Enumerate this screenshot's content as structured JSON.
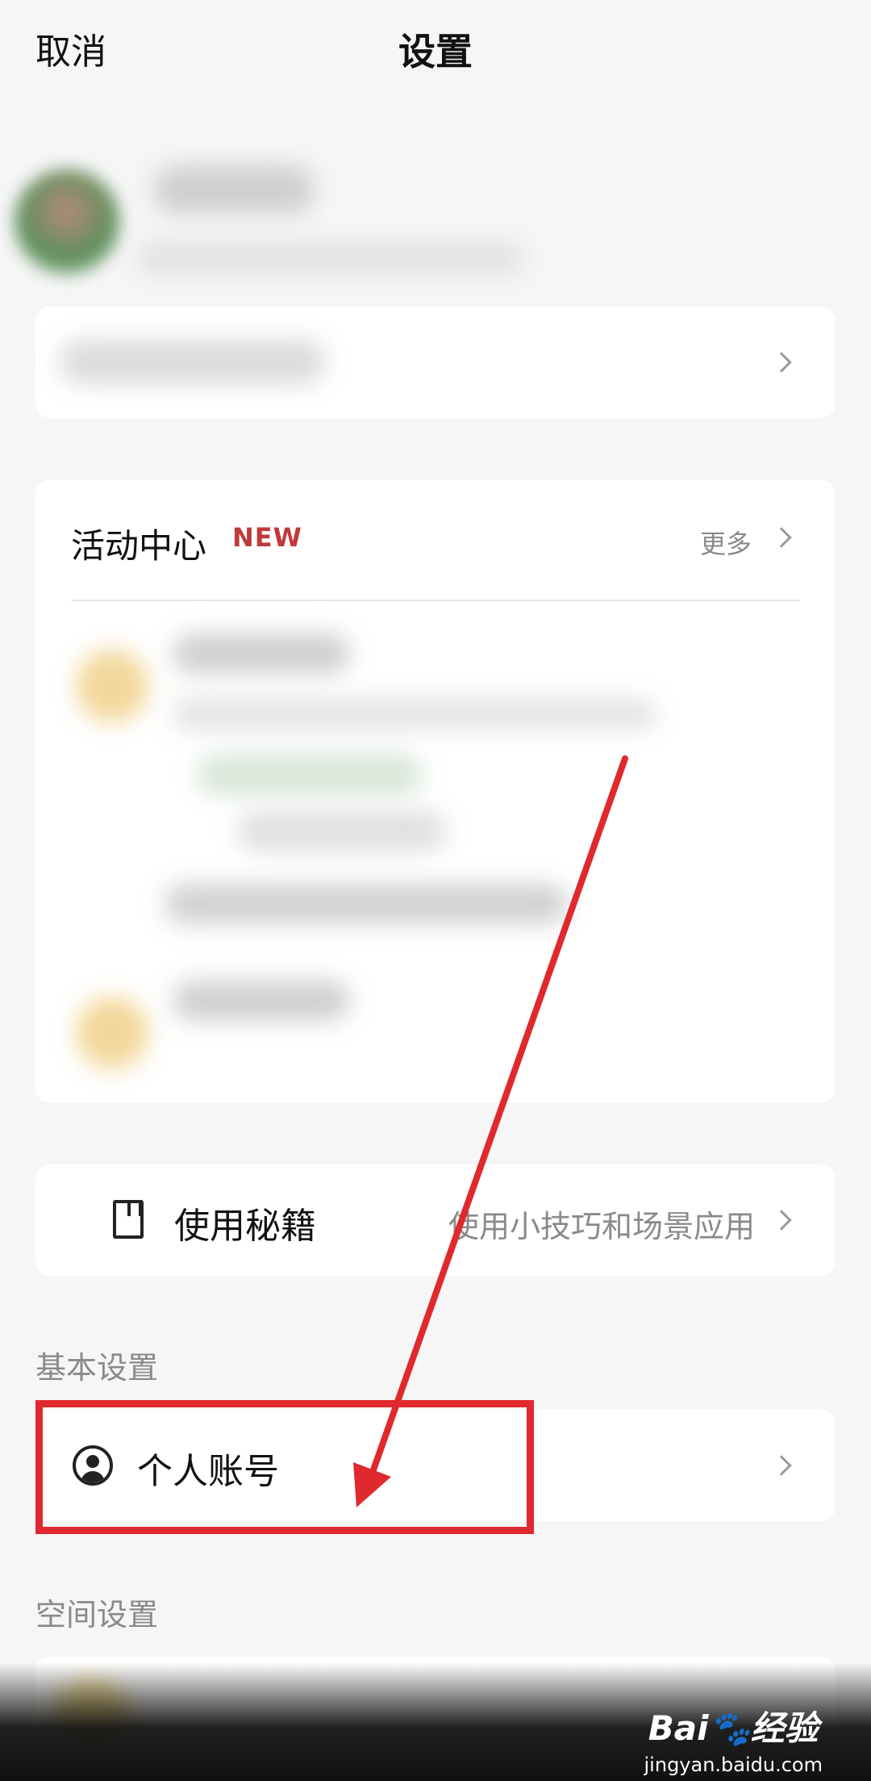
{
  "header": {
    "cancel_label": "取消",
    "title": "设置"
  },
  "activity": {
    "title": "活动中心",
    "badge": "NEW",
    "more_label": "更多"
  },
  "tips": {
    "label": "使用秘籍",
    "description": "使用小技巧和场景应用"
  },
  "sections": {
    "basic_label": "基本设置",
    "space_label": "空间设置"
  },
  "account": {
    "label": "个人账号"
  },
  "watermark": {
    "main": "Bai🐾经验",
    "sub": "jingyan.baidu.com"
  },
  "colors": {
    "highlight": "#e0292e",
    "new_badge": "#c0393b"
  }
}
